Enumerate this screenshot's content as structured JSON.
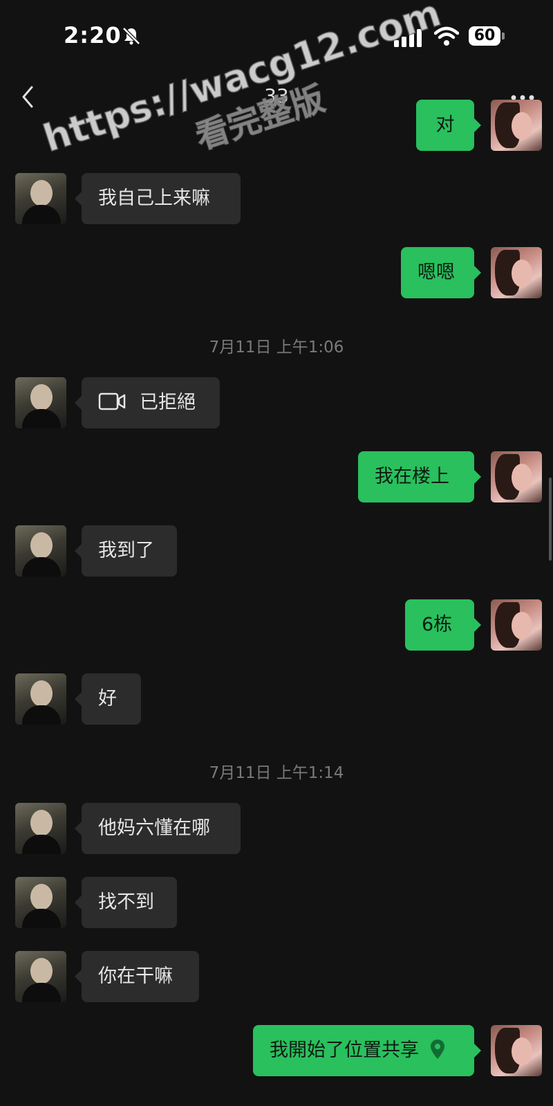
{
  "status_bar": {
    "time": "2:20",
    "battery": "60"
  },
  "nav": {
    "title": "33"
  },
  "watermark": {
    "line1": "https://wacg12.com",
    "line2": "看完整版"
  },
  "messages": [
    {
      "side": "out",
      "text": "对",
      "partial": true
    },
    {
      "side": "in",
      "text": "我自己上来嘛"
    },
    {
      "side": "out",
      "text": "嗯嗯"
    },
    {
      "type": "timestamp",
      "text": "7月11日 上午1:06"
    },
    {
      "side": "in",
      "text": "已拒絕",
      "icon": "video-camera-icon"
    },
    {
      "side": "out",
      "text": "我在楼上"
    },
    {
      "side": "in",
      "text": "我到了"
    },
    {
      "side": "out",
      "text": "6栋"
    },
    {
      "side": "in",
      "text": "好"
    },
    {
      "type": "timestamp",
      "text": "7月11日 上午1:14"
    },
    {
      "side": "in",
      "text": "他妈六懂在哪"
    },
    {
      "side": "in",
      "text": "找不到"
    },
    {
      "side": "in",
      "text": "你在干嘛"
    },
    {
      "side": "out",
      "text": "我開始了位置共享",
      "icon": "location-pin-icon"
    }
  ],
  "colors": {
    "background": "#121212",
    "incoming_bubble": "#2c2c2c",
    "outgoing_bubble": "#29c05d",
    "timestamp_text": "#7a7a7a"
  }
}
